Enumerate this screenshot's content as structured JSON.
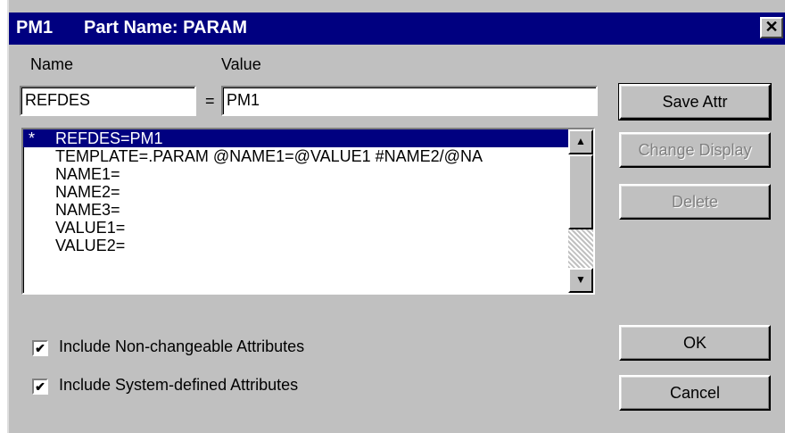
{
  "title": {
    "part1": "PM1",
    "part2": "Part Name: PARAM",
    "close_glyph": "✕"
  },
  "labels": {
    "name": "Name",
    "value": "Value",
    "equals": "="
  },
  "fields": {
    "name_value": "REFDES",
    "value_value": "PM1"
  },
  "list": {
    "rows": [
      {
        "marker": "*",
        "text": "REFDES=PM1"
      },
      {
        "marker": "",
        "text": "TEMPLATE=.PARAM @NAME1=@VALUE1 #NAME2/@NA"
      },
      {
        "marker": "",
        "text": "NAME1="
      },
      {
        "marker": "",
        "text": "NAME2="
      },
      {
        "marker": "",
        "text": "NAME3="
      },
      {
        "marker": "",
        "text": "VALUE1="
      },
      {
        "marker": "",
        "text": "VALUE2="
      }
    ],
    "scroll_up": "▲",
    "scroll_down": "▼"
  },
  "buttons": {
    "save_attr": "Save Attr",
    "change_display": "Change Display",
    "delete": "Delete",
    "ok": "OK",
    "cancel": "Cancel"
  },
  "checkboxes": {
    "nonchangeable": {
      "label": "Include Non-changeable Attributes",
      "checked": true
    },
    "system": {
      "label": "Include System-defined Attributes",
      "checked": true
    }
  },
  "colors": {
    "titlebar": "#000080",
    "face": "#c0c0c0",
    "selection": "#000080"
  }
}
